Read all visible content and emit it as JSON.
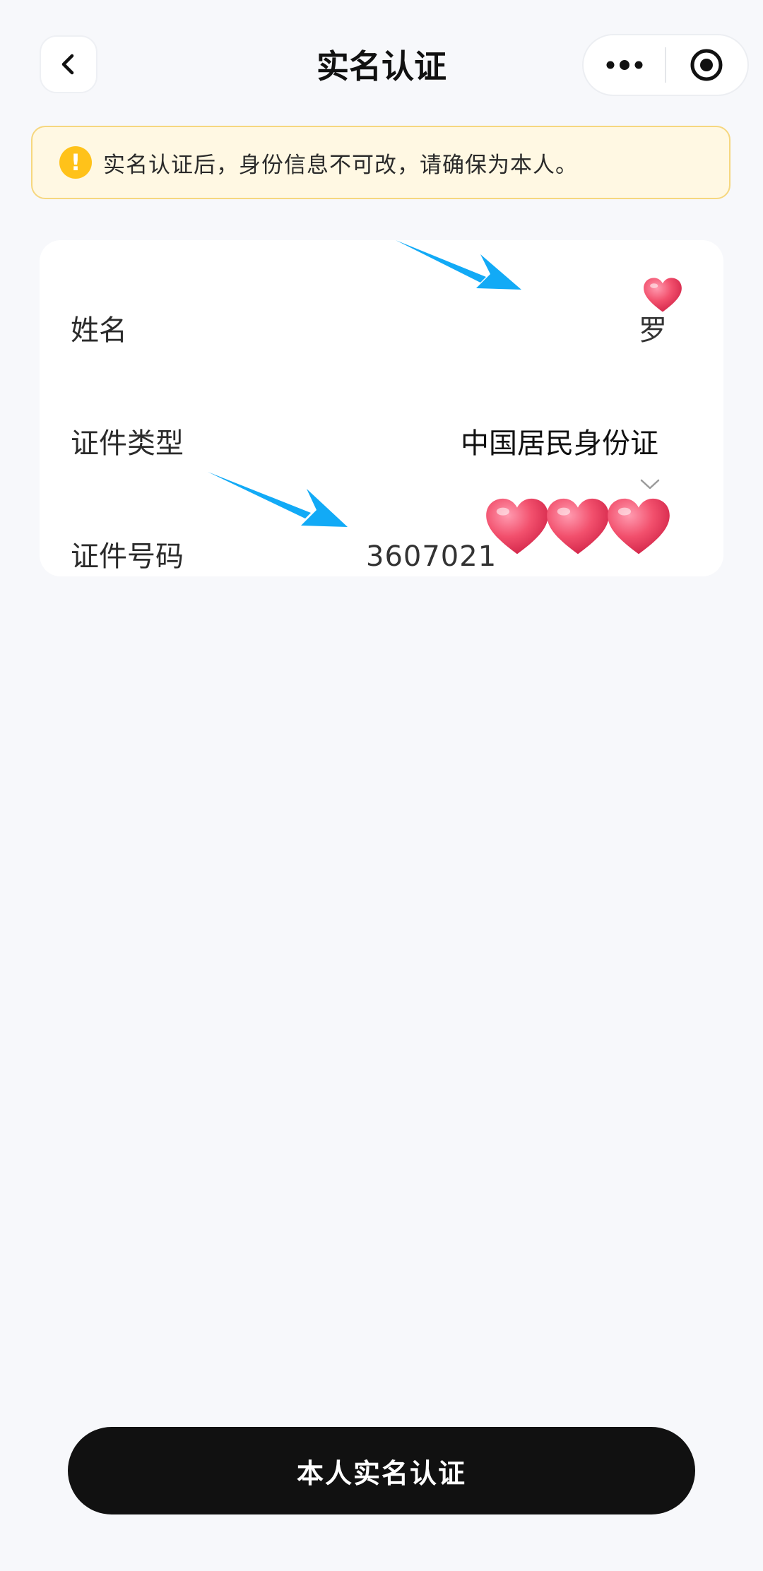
{
  "header": {
    "title": "实名认证",
    "back_icon": "chevron-left-icon",
    "more_icon": "more-dots-icon",
    "close_icon": "target-circle-icon"
  },
  "notice": {
    "icon": "exclamation-icon",
    "text": "实名认证后，身份信息不可改，请确保为本人。",
    "colors": {
      "background": "#fff8e3",
      "border": "#f6d77f",
      "icon": "#ffc21a"
    }
  },
  "form": {
    "name": {
      "label": "姓名",
      "value": "罗"
    },
    "id_type": {
      "label": "证件类型",
      "value": "中国居民身份证",
      "icon": "chevron-down-icon"
    },
    "id_number": {
      "label": "证件号码",
      "value": "3607021"
    }
  },
  "overlays": {
    "arrow_icon": "arrow-icon",
    "heart_icon": "heart-sticker-icon",
    "arrow_color": "#12aaf6",
    "heart_color": "#f2506d"
  },
  "submit": {
    "label": "本人实名认证"
  }
}
